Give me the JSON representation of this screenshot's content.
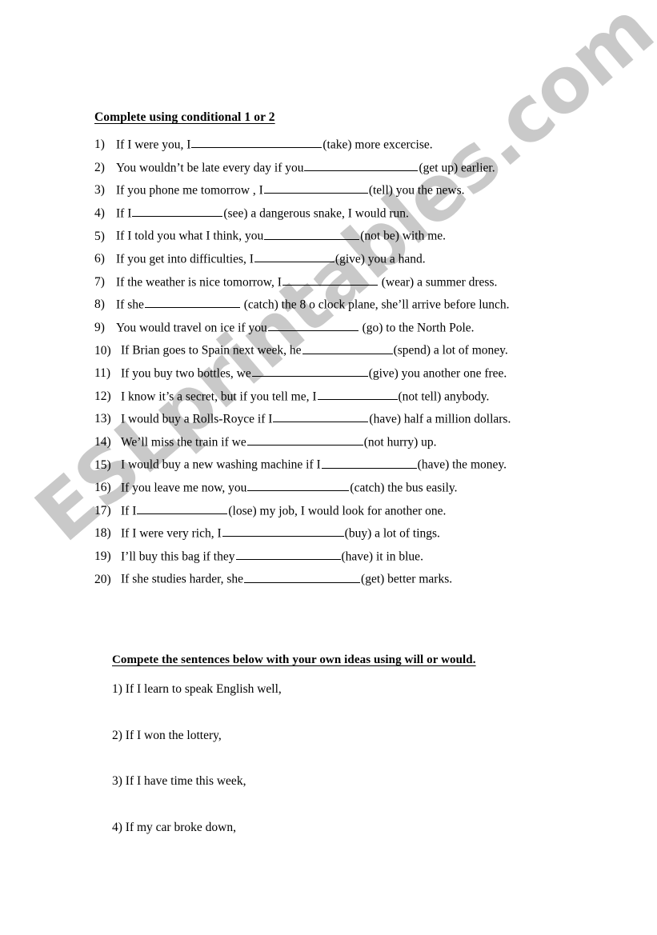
{
  "document": {
    "background_color": "#ffffff",
    "text_color": "#000000"
  },
  "watermark": {
    "text": "ESLprintables.com",
    "color": "#c9c9c9",
    "rotation_deg": -40.5
  },
  "section1": {
    "heading": "Complete using conditional 1 or 2",
    "items": [
      {
        "number": "1)",
        "before": "If I were you, I",
        "blank_width": 163,
        "after": "(take) more excercise."
      },
      {
        "number": "2)",
        "before": "You wouldn’t be late every day if you",
        "blank_width": 142,
        "after": "(get up) earlier."
      },
      {
        "number": "3)",
        "before": "If you phone me tomorrow , I",
        "blank_width": 130,
        "after": "(tell) you the news."
      },
      {
        "number": "4)",
        "before": "If I",
        "blank_width": 113,
        "after": "(see) a dangerous snake, I would run."
      },
      {
        "number": "5)",
        "before": "If I told you what I think, you",
        "blank_width": 119,
        "after": "(not be) with me."
      },
      {
        "number": "6)",
        "before": "If you get into difficulties, I",
        "blank_width": 100,
        "after": "(give) you a hand."
      },
      {
        "number": "7)",
        "before": "If the weather is nice tomorrow, I",
        "blank_width": 119,
        "after": " (wear) a summer dress."
      },
      {
        "number": "8)",
        "before": "If she",
        "blank_width": 119,
        "after": " (catch) the 8 o clock plane, she’ll arrive before lunch."
      },
      {
        "number": "9)",
        "before": "You would travel on ice if you",
        "blank_width": 113,
        "after": " (go) to the North Pole."
      },
      {
        "number": "10)",
        "before": "If Brian goes to Spain next week, he",
        "blank_width": 113,
        "after": "(spend) a lot of money."
      },
      {
        "number": "11)",
        "before": "If you buy two bottles, we",
        "blank_width": 145,
        "after": "(give) you another one free."
      },
      {
        "number": "12)",
        "before": "I know it’s a secret, but if you tell me, I",
        "blank_width": 100,
        "after": "(not tell) anybody."
      },
      {
        "number": "13)",
        "before": "I would buy a Rolls-Royce if I",
        "blank_width": 119,
        "after": "(have) half a million dollars."
      },
      {
        "number": "14)",
        "before": "We’ll miss the train if we",
        "blank_width": 145,
        "after": "(not hurry) up."
      },
      {
        "number": "15)",
        "before": "I would buy a new washing machine if I",
        "blank_width": 119,
        "after": "(have) the money."
      },
      {
        "number": "16)",
        "before": "If you leave me now, you",
        "blank_width": 127,
        "after": "(catch) the bus easily."
      },
      {
        "number": "17)",
        "before": "If  I",
        "blank_width": 113,
        "after": "(lose) my job, I would look for another one."
      },
      {
        "number": "18)",
        "before": "If I were very rich, I",
        "blank_width": 152,
        "after": "(buy) a lot of tings."
      },
      {
        "number": "19)",
        "before": "I’ll buy this bag if they",
        "blank_width": 131,
        "after": "(have) it in blue."
      },
      {
        "number": "20)",
        "before": "If she studies harder, she",
        "blank_width": 145,
        "after": "(get) better marks."
      }
    ]
  },
  "section2": {
    "heading": "Compete the sentences below with your own ideas using will or would.",
    "items": [
      {
        "number": "1)",
        "text": "If I learn to speak English well,"
      },
      {
        "number": "2)",
        "text": "If I won the lottery,"
      },
      {
        "number": "3)",
        "text": "If I have time this week,"
      },
      {
        "number": "4)",
        "text": "If my car broke down,"
      }
    ]
  }
}
